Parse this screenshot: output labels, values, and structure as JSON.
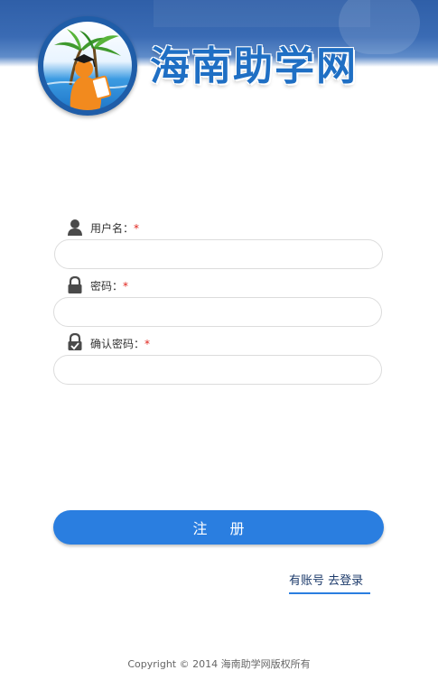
{
  "site": {
    "title": "海南助学网"
  },
  "form": {
    "username": {
      "label": "用户名：",
      "required_mark": "*",
      "value": "",
      "placeholder": ""
    },
    "password": {
      "label": "密码：",
      "required_mark": "*",
      "value": "",
      "placeholder": ""
    },
    "confirm_password": {
      "label": "确认密码：",
      "required_mark": "*",
      "value": "",
      "placeholder": ""
    },
    "register_button": "注 册"
  },
  "links": {
    "login": "有账号 去登录"
  },
  "footer": {
    "copyright": "Copyright © 2014 海南助学网版权所有"
  },
  "colors": {
    "accent": "#2a7ee0",
    "required": "#e0241c",
    "header": "#2f5fa8"
  },
  "icons": {
    "username": "user-icon",
    "password": "lock-icon",
    "confirm_password": "lock-check-icon"
  }
}
